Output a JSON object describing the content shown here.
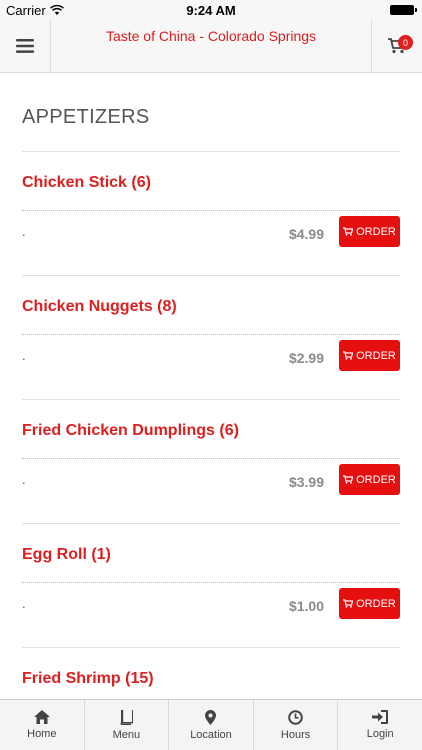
{
  "status_bar": {
    "carrier": "Carrier",
    "time": "9:24 AM"
  },
  "header": {
    "title": "Taste of China - Colorado Springs",
    "cart_count": "0"
  },
  "section": {
    "title": "APPETIZERS"
  },
  "items": [
    {
      "name": "Chicken Stick (6)",
      "description": ".",
      "price": "$4.99",
      "order_label": "ORDER"
    },
    {
      "name": "Chicken Nuggets (8)",
      "description": ".",
      "price": "$2.99",
      "order_label": "ORDER"
    },
    {
      "name": "Fried Chicken Dumplings (6)",
      "description": ".",
      "price": "$3.99",
      "order_label": "ORDER"
    },
    {
      "name": "Egg Roll (1)",
      "description": ".",
      "price": "$1.00",
      "order_label": "ORDER"
    },
    {
      "name": "Fried Shrimp (15)",
      "description": "",
      "price": "",
      "order_label": ""
    }
  ],
  "tabbar": {
    "tabs": [
      {
        "label": "Home",
        "icon": "home-icon"
      },
      {
        "label": "Menu",
        "icon": "book-icon"
      },
      {
        "label": "Location",
        "icon": "map-pin-icon"
      },
      {
        "label": "Hours",
        "icon": "clock-icon"
      },
      {
        "label": "Login",
        "icon": "login-icon"
      }
    ]
  },
  "colors": {
    "accent": "#e50f0f",
    "title_red": "#e11d1d",
    "price_gray": "#8a8a8a"
  }
}
